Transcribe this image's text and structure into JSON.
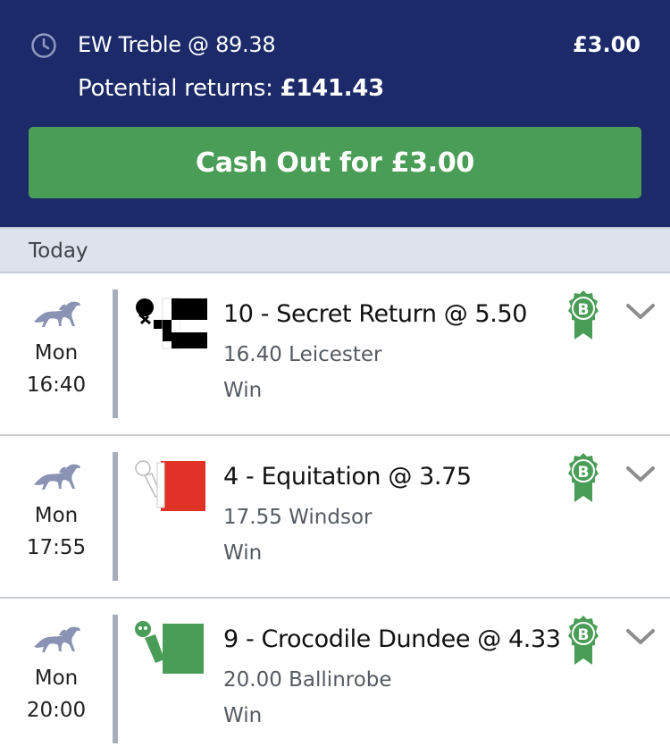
{
  "header": {
    "bet_title": "EW Treble @ 89.38",
    "stake": "£3.00",
    "returns_label": "Potential returns:",
    "returns_value": "£141.43",
    "cashout_label": "Cash Out for £3.00",
    "icon": "clock-icon"
  },
  "section": {
    "label": "Today"
  },
  "legs": [
    {
      "day": "Mon",
      "time": "16:40",
      "selection": "10 - Secret Return @ 5.50",
      "race": "16.40 Leicester",
      "market": "Win",
      "silk": "black-white-check",
      "badge": "B"
    },
    {
      "day": "Mon",
      "time": "17:55",
      "selection": "4 - Equitation @ 3.75",
      "race": "17.55 Windsor",
      "market": "Win",
      "silk": "red-white",
      "badge": "B"
    },
    {
      "day": "Mon",
      "time": "20:00",
      "selection": "9 - Crocodile Dundee @ 4.33",
      "race": "20.00 Ballinrobe",
      "market": "Win",
      "silk": "green",
      "badge": "B"
    }
  ],
  "colors": {
    "header_bg": "#1c2a6a",
    "cashout_bg": "#4a9d57",
    "badge": "#4a9d57",
    "section_bg": "#dde2ec"
  }
}
